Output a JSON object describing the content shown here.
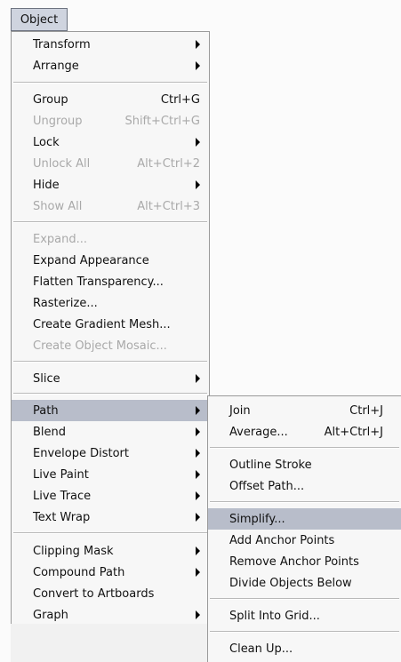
{
  "menubar": {
    "title": "Object"
  },
  "menu": {
    "items": [
      {
        "label": "Transform",
        "shortcut": "",
        "submenu": true,
        "disabled": false,
        "selected": false
      },
      {
        "label": "Arrange",
        "shortcut": "",
        "submenu": true,
        "disabled": false,
        "selected": false
      },
      {
        "label": "Group",
        "shortcut": "Ctrl+G",
        "submenu": false,
        "disabled": false,
        "selected": false
      },
      {
        "label": "Ungroup",
        "shortcut": "Shift+Ctrl+G",
        "submenu": false,
        "disabled": true,
        "selected": false
      },
      {
        "label": "Lock",
        "shortcut": "",
        "submenu": true,
        "disabled": false,
        "selected": false
      },
      {
        "label": "Unlock All",
        "shortcut": "Alt+Ctrl+2",
        "submenu": false,
        "disabled": true,
        "selected": false
      },
      {
        "label": "Hide",
        "shortcut": "",
        "submenu": true,
        "disabled": false,
        "selected": false
      },
      {
        "label": "Show All",
        "shortcut": "Alt+Ctrl+3",
        "submenu": false,
        "disabled": true,
        "selected": false
      },
      {
        "label": "Expand...",
        "shortcut": "",
        "submenu": false,
        "disabled": true,
        "selected": false
      },
      {
        "label": "Expand Appearance",
        "shortcut": "",
        "submenu": false,
        "disabled": false,
        "selected": false
      },
      {
        "label": "Flatten Transparency...",
        "shortcut": "",
        "submenu": false,
        "disabled": false,
        "selected": false
      },
      {
        "label": "Rasterize...",
        "shortcut": "",
        "submenu": false,
        "disabled": false,
        "selected": false
      },
      {
        "label": "Create Gradient Mesh...",
        "shortcut": "",
        "submenu": false,
        "disabled": false,
        "selected": false
      },
      {
        "label": "Create Object Mosaic...",
        "shortcut": "",
        "submenu": false,
        "disabled": true,
        "selected": false
      },
      {
        "label": "Slice",
        "shortcut": "",
        "submenu": true,
        "disabled": false,
        "selected": false
      },
      {
        "label": "Path",
        "shortcut": "",
        "submenu": true,
        "disabled": false,
        "selected": true
      },
      {
        "label": "Blend",
        "shortcut": "",
        "submenu": true,
        "disabled": false,
        "selected": false
      },
      {
        "label": "Envelope Distort",
        "shortcut": "",
        "submenu": true,
        "disabled": false,
        "selected": false
      },
      {
        "label": "Live Paint",
        "shortcut": "",
        "submenu": true,
        "disabled": false,
        "selected": false
      },
      {
        "label": "Live Trace",
        "shortcut": "",
        "submenu": true,
        "disabled": false,
        "selected": false
      },
      {
        "label": "Text Wrap",
        "shortcut": "",
        "submenu": true,
        "disabled": false,
        "selected": false
      },
      {
        "label": "Clipping Mask",
        "shortcut": "",
        "submenu": true,
        "disabled": false,
        "selected": false
      },
      {
        "label": "Compound Path",
        "shortcut": "",
        "submenu": true,
        "disabled": false,
        "selected": false
      },
      {
        "label": "Convert to Artboards",
        "shortcut": "",
        "submenu": false,
        "disabled": false,
        "selected": false
      },
      {
        "label": "Graph",
        "shortcut": "",
        "submenu": true,
        "disabled": false,
        "selected": false
      }
    ]
  },
  "submenu": {
    "items": [
      {
        "label": "Join",
        "shortcut": "Ctrl+J",
        "selected": false
      },
      {
        "label": "Average...",
        "shortcut": "Alt+Ctrl+J",
        "selected": false
      },
      {
        "label": "Outline Stroke",
        "shortcut": "",
        "selected": false
      },
      {
        "label": "Offset Path...",
        "shortcut": "",
        "selected": false
      },
      {
        "label": "Simplify...",
        "shortcut": "",
        "selected": true
      },
      {
        "label": "Add Anchor Points",
        "shortcut": "",
        "selected": false
      },
      {
        "label": "Remove Anchor Points",
        "shortcut": "",
        "selected": false
      },
      {
        "label": "Divide Objects Below",
        "shortcut": "",
        "selected": false
      },
      {
        "label": "Split Into Grid...",
        "shortcut": "",
        "selected": false
      },
      {
        "label": "Clean Up...",
        "shortcut": "",
        "selected": false
      }
    ]
  }
}
